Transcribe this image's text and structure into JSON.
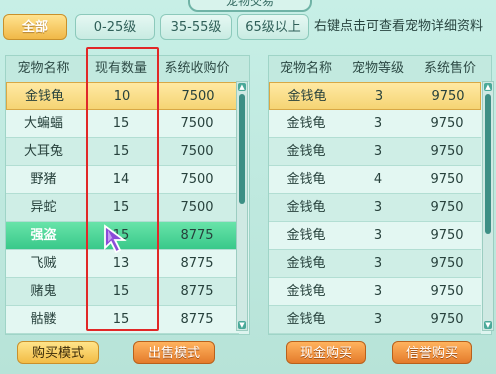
{
  "window": {
    "title": "宠物交易"
  },
  "filters": [
    {
      "label": "全部",
      "active": true
    },
    {
      "label": "0-25级",
      "active": false
    },
    {
      "label": "35-55级",
      "active": false
    },
    {
      "label": "65级以上",
      "active": false
    }
  ],
  "hint": "右键点击可查看宠物详细资料",
  "buy_table": {
    "headers": [
      "宠物名称",
      "现有数量",
      "系统收购价"
    ],
    "rows": [
      {
        "name": "金钱龟",
        "qty": "10",
        "price": "7500"
      },
      {
        "name": "大蝙蝠",
        "qty": "15",
        "price": "7500"
      },
      {
        "name": "大耳兔",
        "qty": "15",
        "price": "7500"
      },
      {
        "name": "野猪",
        "qty": "14",
        "price": "7500"
      },
      {
        "name": "异蛇",
        "qty": "15",
        "price": "7500"
      },
      {
        "name": "强盗",
        "qty": "15",
        "price": "8775"
      },
      {
        "name": "飞贼",
        "qty": "13",
        "price": "8775"
      },
      {
        "name": "赌鬼",
        "qty": "15",
        "price": "8775"
      },
      {
        "name": "骷髅",
        "qty": "15",
        "price": "8775"
      }
    ]
  },
  "sell_table": {
    "headers": [
      "宠物名称",
      "宠物等级",
      "系统售价"
    ],
    "rows": [
      {
        "name": "金钱龟",
        "level": "3",
        "price": "9750"
      },
      {
        "name": "金钱龟",
        "level": "3",
        "price": "9750"
      },
      {
        "name": "金钱龟",
        "level": "3",
        "price": "9750"
      },
      {
        "name": "金钱龟",
        "level": "4",
        "price": "9750"
      },
      {
        "name": "金钱龟",
        "level": "3",
        "price": "9750"
      },
      {
        "name": "金钱龟",
        "level": "3",
        "price": "9750"
      },
      {
        "name": "金钱龟",
        "level": "3",
        "price": "9750"
      },
      {
        "name": "金钱龟",
        "level": "3",
        "price": "9750"
      },
      {
        "name": "金钱龟",
        "level": "3",
        "price": "9750"
      }
    ]
  },
  "buttons": {
    "buy_mode": "购买模式",
    "sell_mode": "出售模式",
    "cash_buy": "现金购买",
    "credit_buy": "信誉购买"
  },
  "colors": {
    "accent": "#f2bc45",
    "highlight": "#39c98a",
    "annotation_box": "#e12727"
  },
  "icons": {
    "cursor": "pointer-cursor-icon",
    "up": "scroll-up-arrow-icon",
    "down": "scroll-down-arrow-icon"
  }
}
